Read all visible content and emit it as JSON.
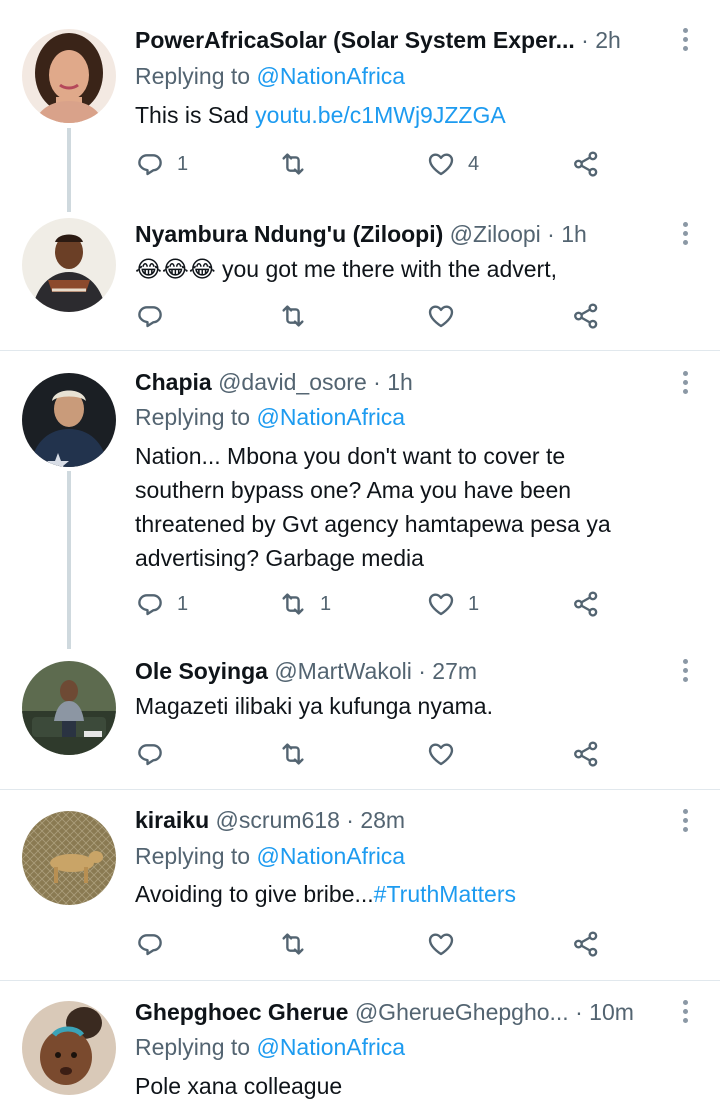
{
  "tweets": [
    {
      "name": "PowerAfricaSolar (Solar System Exper...",
      "handle": "",
      "time": "2h",
      "replying_prefix": "Replying to",
      "replying_to": "@NationAfrica",
      "body_text": "This is Sad ",
      "body_link": "youtu.be/c1MWj9JZZGA",
      "reply_count": "1",
      "retweet_count": "",
      "like_count": "4"
    },
    {
      "name": "Nyambura Ndung'u (Ziloopi)",
      "handle": "@Ziloopi",
      "time": "1h",
      "emoji": "😂😂😂",
      "body_text": " you got me there with the advert,",
      "reply_count": "",
      "retweet_count": "",
      "like_count": ""
    },
    {
      "name": "Chapia",
      "handle": "@david_osore",
      "time": "1h",
      "replying_prefix": "Replying to",
      "replying_to": "@NationAfrica",
      "body_lines": [
        "Nation... Mbona you don't want to cover te",
        "southern bypass one? Ama you have been",
        "threatened by Gvt agency hamtapewa pesa ya",
        "advertising? Garbage media"
      ],
      "reply_count": "1",
      "retweet_count": "1",
      "like_count": "1"
    },
    {
      "name": "Ole Soyinga",
      "handle": "@MartWakoli",
      "time": "27m",
      "body_text": "Magazeti ilibaki ya kufunga nyama.",
      "reply_count": "",
      "retweet_count": "",
      "like_count": ""
    },
    {
      "name": "kiraiku",
      "handle": "@scrum618",
      "time": "28m",
      "replying_prefix": "Replying to",
      "replying_to": "@NationAfrica",
      "body_text": "Avoiding to give bribe...",
      "body_link": "#TruthMatters",
      "reply_count": "",
      "retweet_count": "",
      "like_count": ""
    },
    {
      "name": "Ghepghoec Gherue",
      "handle": "@GherueGhepgho...",
      "time": "10m",
      "replying_prefix": "Replying to",
      "replying_to": "@NationAfrica",
      "body_text": "Pole xana colleague"
    }
  ],
  "separator": "·",
  "icons": {
    "reply": "reply-icon",
    "retweet": "retweet-icon",
    "like": "heart-icon",
    "share": "share-icon",
    "more": "more-dots-icon"
  },
  "colors": {
    "link": "#1d9bf0",
    "muted": "#536471",
    "text": "#0f1419",
    "thread_line": "#cfd9de",
    "divider": "#e1e8ed"
  }
}
